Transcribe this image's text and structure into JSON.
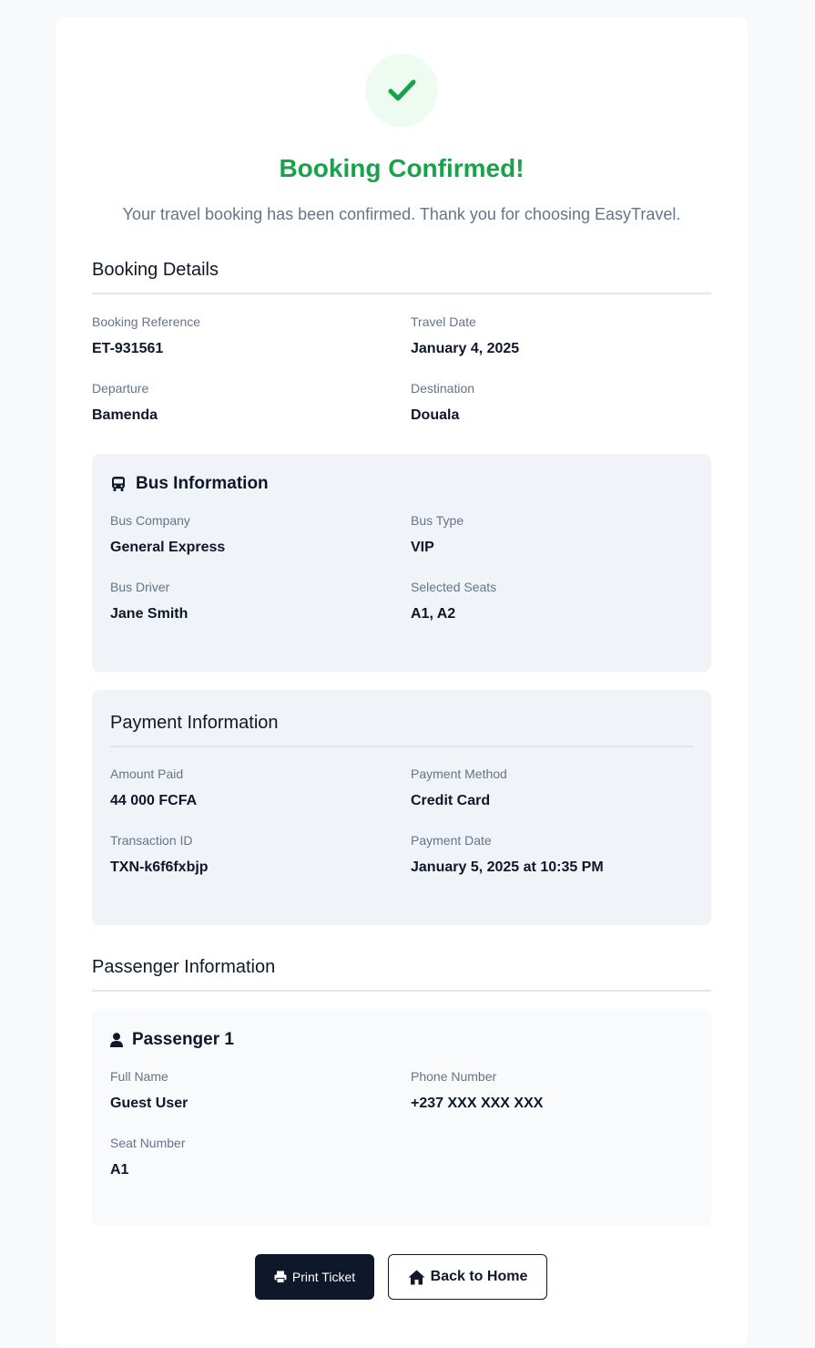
{
  "header": {
    "title": "Booking Confirmed!",
    "subtitle": "Your travel booking has been confirmed. Thank you for choosing EasyTravel."
  },
  "booking_details": {
    "heading": "Booking Details",
    "fields": [
      {
        "label": "Booking Reference",
        "value": "ET-931561"
      },
      {
        "label": "Travel Date",
        "value": "January 4, 2025"
      },
      {
        "label": "Departure",
        "value": "Bamenda"
      },
      {
        "label": "Destination",
        "value": "Douala"
      }
    ]
  },
  "bus_info": {
    "heading": "Bus Information",
    "icon": "bus-icon",
    "fields": [
      {
        "label": "Bus Company",
        "value": "General Express"
      },
      {
        "label": "Bus Type",
        "value": "VIP"
      },
      {
        "label": "Bus Driver",
        "value": "Jane Smith"
      },
      {
        "label": "Selected Seats",
        "value": "A1, A2"
      }
    ]
  },
  "payment_info": {
    "heading": "Payment Information",
    "fields": [
      {
        "label": "Amount Paid",
        "value": "44 000 FCFA"
      },
      {
        "label": "Payment Method",
        "value": "Credit Card"
      },
      {
        "label": "Transaction ID",
        "value": "TXN-k6f6fxbjp"
      },
      {
        "label": "Payment Date",
        "value": "January 5, 2025 at 10:35 PM"
      }
    ]
  },
  "passenger_info": {
    "heading": "Passenger Information",
    "passengers": [
      {
        "title": "Passenger 1",
        "icon": "user-icon",
        "fields": [
          {
            "label": "Full Name",
            "value": "Guest User"
          },
          {
            "label": "Phone Number",
            "value": "+237 XXX XXX XXX"
          },
          {
            "label": "Seat Number",
            "value": "A1"
          }
        ]
      }
    ]
  },
  "actions": {
    "print_label": "Print Ticket",
    "home_label": "Back to Home"
  },
  "colors": {
    "success": "#16a34a",
    "success_bg": "#eefbf1",
    "dark": "#0f172a",
    "muted": "#64748b",
    "panel_bg": "#f0f4f8"
  }
}
